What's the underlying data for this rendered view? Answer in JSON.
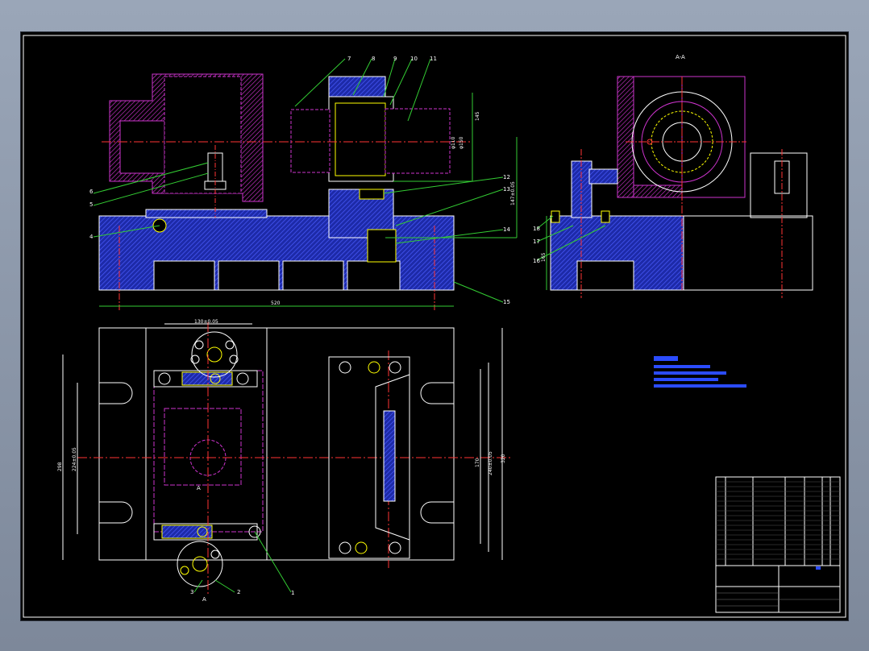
{
  "drawing": {
    "section_label": "A-A",
    "part_numbers": [
      "1",
      "2",
      "3",
      "4",
      "5",
      "6",
      "7",
      "8",
      "9",
      "10",
      "11",
      "12",
      "13",
      "14",
      "15",
      "16",
      "17",
      "18"
    ],
    "dimensions": {
      "overall_length": "520",
      "height_a": "145",
      "height_b": "147±0.05",
      "width_top": "130±0.05",
      "left_outer": "298",
      "left_inner": "224±0.05",
      "right_inner": "170",
      "right_mid": "240±0.05",
      "right_outer": "320",
      "side_height": "165",
      "bore_1": "φ110",
      "bore_2": "φ150"
    },
    "section_mark": "A"
  },
  "colors": {
    "background": "#000000",
    "outline": "#ffffff",
    "part": "#cc33cc",
    "base": "#2b3fd6",
    "dimension": "#33cc33",
    "centerline": "#ff3333",
    "highlight": "#ffff00"
  }
}
